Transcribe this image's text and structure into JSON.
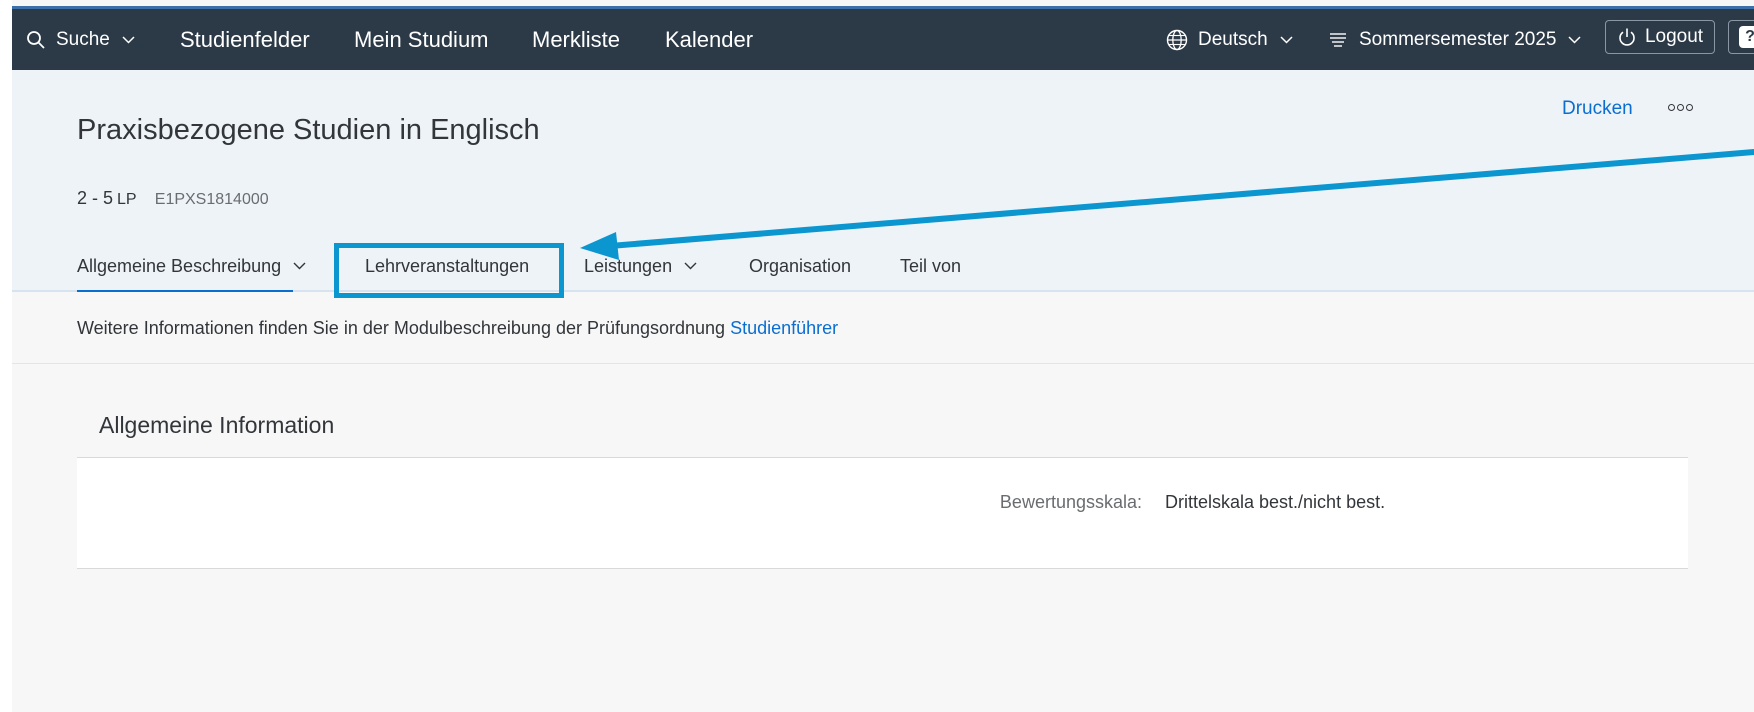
{
  "shell": {
    "search_label": "Suche",
    "nav": [
      "Studienfelder",
      "Mein Studium",
      "Merkliste",
      "Kalender"
    ],
    "language": "Deutsch",
    "semester": "Sommersemester 2025",
    "logout_label": "Logout",
    "help_label": "?"
  },
  "header": {
    "title": "Praxisbezogene Studien in Englisch",
    "credits": "2 - 5",
    "credits_unit": "LP",
    "code": "E1PXS1814000",
    "print_label": "Drucken"
  },
  "tabs": [
    {
      "label": "Allgemeine Beschreibung"
    },
    {
      "label": "Lehrveranstaltungen"
    },
    {
      "label": "Leistungen"
    },
    {
      "label": "Organisation"
    },
    {
      "label": "Teil von"
    }
  ],
  "infobar": {
    "text": "Weitere Informationen finden Sie in der Modulbeschreibung der Prüfungsordnung",
    "link": "Studienführer"
  },
  "section": {
    "title": "Allgemeine Information",
    "field_label": "Bewertungsskala:",
    "field_value": "Drittelskala best./nicht best."
  },
  "colors": {
    "shell_bg": "#2c3a48",
    "header_bg": "#eef3f8",
    "accent": "#0a6ed1",
    "annotation": "#0b96cf"
  }
}
